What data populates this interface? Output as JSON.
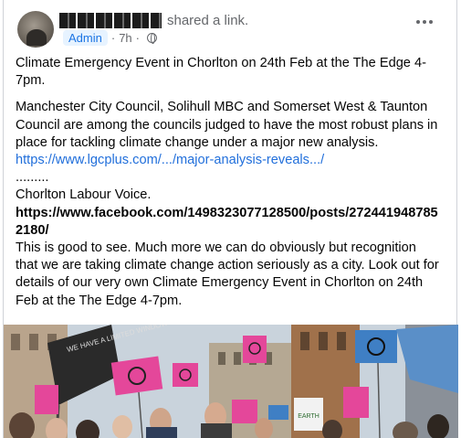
{
  "post": {
    "author_action": "shared a link.",
    "badge": "Admin",
    "separator": "·",
    "time": "7h",
    "privacy_icon": "globe-icon",
    "menu_icon": "more-options-icon",
    "text": {
      "line1": "Climate Emergency Event in Chorlton on 24th Feb at the The Edge 4-7pm.",
      "para2": "Manchester City Council, Solihull MBC and Somerset West & Taunton Council are among the councils judged to have the most robust plans in place for tackling climate change under a major new analysis.",
      "link": "https://www.lgcplus.com/.../major-analysis-reveals.../",
      "dots": ".........",
      "source": "Chorlton Labour Voice.",
      "source_url": "https://www.facebook.com/1498323077128500/posts/2724419487852180/",
      "para3": "This is good to see. Much more we can do obviously but recognition that we are taking  climate change action seriously as a city. Look out for details of our very own Climate Emergency Event in Chorlton on 24th Feb at the The Edge 4-7pm."
    },
    "photo": {
      "banner_text": "WE HAVE A LIMITED WINDOW OF CHANCE",
      "sign_text": "EARTH",
      "flag_color": "#e4479a",
      "sky_color": "#c9d3dc"
    }
  }
}
